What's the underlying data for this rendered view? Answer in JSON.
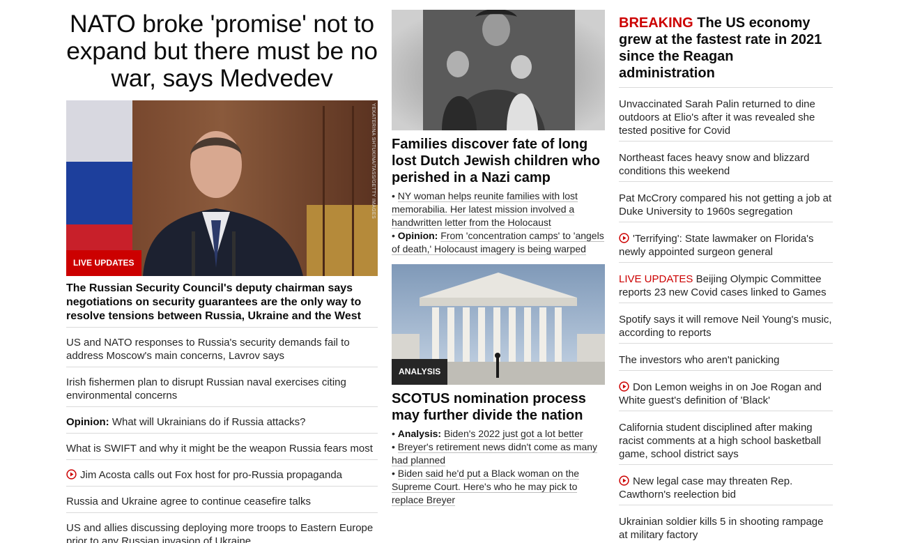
{
  "main": {
    "headline": "NATO broke 'promise' not to expand but there must be no war, says Medvedev",
    "badge": "LIVE UPDATES",
    "photo_credit": "YEKATERINA SHTUKINA/TASS/GETTY IMAGES",
    "summary": "The Russian Security Council's deputy chairman says negotiations on security guarantees are the only way to resolve tensions between Russia, Ukraine and the West",
    "list": [
      {
        "tag": "",
        "video": false,
        "text": "US and NATO responses to Russia's security demands fail to address Moscow's main concerns, Lavrov says"
      },
      {
        "tag": "",
        "video": false,
        "text": "Irish fishermen plan to disrupt Russian naval exercises citing environmental concerns"
      },
      {
        "tag": "Opinion:",
        "video": false,
        "text": "What will Ukrainians do if Russia attacks?"
      },
      {
        "tag": "",
        "video": false,
        "text": "What is SWIFT and why it might be the weapon Russia fears most"
      },
      {
        "tag": "",
        "video": true,
        "text": "Jim Acosta calls out Fox host for pro-Russia propaganda"
      },
      {
        "tag": "",
        "video": false,
        "text": "Russia and Ukraine agree to continue ceasefire talks"
      },
      {
        "tag": "",
        "video": false,
        "text": "US and allies discussing deploying more troops to Eastern Europe prior to any Russian invasion of Ukraine"
      }
    ]
  },
  "middle": {
    "story1": {
      "headline": "Families discover fate of long lost Dutch Jewish children who perished in a Nazi camp",
      "links": [
        {
          "tag": "",
          "text": "NY woman helps reunite families with lost memorabilia. Her latest mission involved a handwritten letter from the Holocaust"
        },
        {
          "tag": "Opinion:",
          "text": "From 'concentration camps' to 'angels of death,' Holocaust imagery is being warped"
        }
      ]
    },
    "story2": {
      "badge": "ANALYSIS",
      "headline": "SCOTUS nomination process may further divide the nation",
      "links": [
        {
          "tag": "Analysis:",
          "text": "Biden's 2022 just got a lot better"
        },
        {
          "tag": "",
          "text": "Breyer's retirement news didn't come as many had planned"
        },
        {
          "tag": "",
          "text": "Biden said he'd put a Black woman on the Supreme Court. Here's who he may pick to replace Breyer"
        }
      ]
    },
    "bullet": "•"
  },
  "right": {
    "breaking_label": "BREAKING",
    "breaking_text": "The US economy grew at the fastest rate in 2021 since the Reagan administration",
    "list": [
      {
        "prefix": "",
        "video": false,
        "text": "Unvaccinated Sarah Palin returned to dine outdoors at Elio's after it was revealed she tested positive for Covid"
      },
      {
        "prefix": "",
        "video": false,
        "text": "Northeast faces heavy snow and blizzard conditions this weekend"
      },
      {
        "prefix": "",
        "video": false,
        "text": "Pat McCrory compared his not getting a job at Duke University to 1960s segregation"
      },
      {
        "prefix": "",
        "video": true,
        "text": "'Terrifying': State lawmaker on Florida's newly appointed surgeon general"
      },
      {
        "prefix": "LIVE UPDATES",
        "video": false,
        "text": "Beijing Olympic Committee reports 23 new Covid cases linked to Games"
      },
      {
        "prefix": "",
        "video": false,
        "text": "Spotify says it will remove Neil Young's music, according to reports"
      },
      {
        "prefix": "",
        "video": false,
        "text": "The investors who aren't panicking"
      },
      {
        "prefix": "",
        "video": true,
        "text": "Don Lemon weighs in on Joe Rogan and White guest's definition of 'Black'"
      },
      {
        "prefix": "",
        "video": false,
        "text": "California student disciplined after making racist comments at a high school basketball game, school district says"
      },
      {
        "prefix": "",
        "video": true,
        "text": "New legal case may threaten Rep. Cawthorn's reelection bid"
      },
      {
        "prefix": "",
        "video": false,
        "text": "Ukrainian soldier kills 5 in shooting rampage at military factory"
      }
    ]
  },
  "colors": {
    "accent": "#cc0000",
    "text": "#262626",
    "divider": "#dadada"
  },
  "icons": {
    "video": "play-circle-icon"
  }
}
